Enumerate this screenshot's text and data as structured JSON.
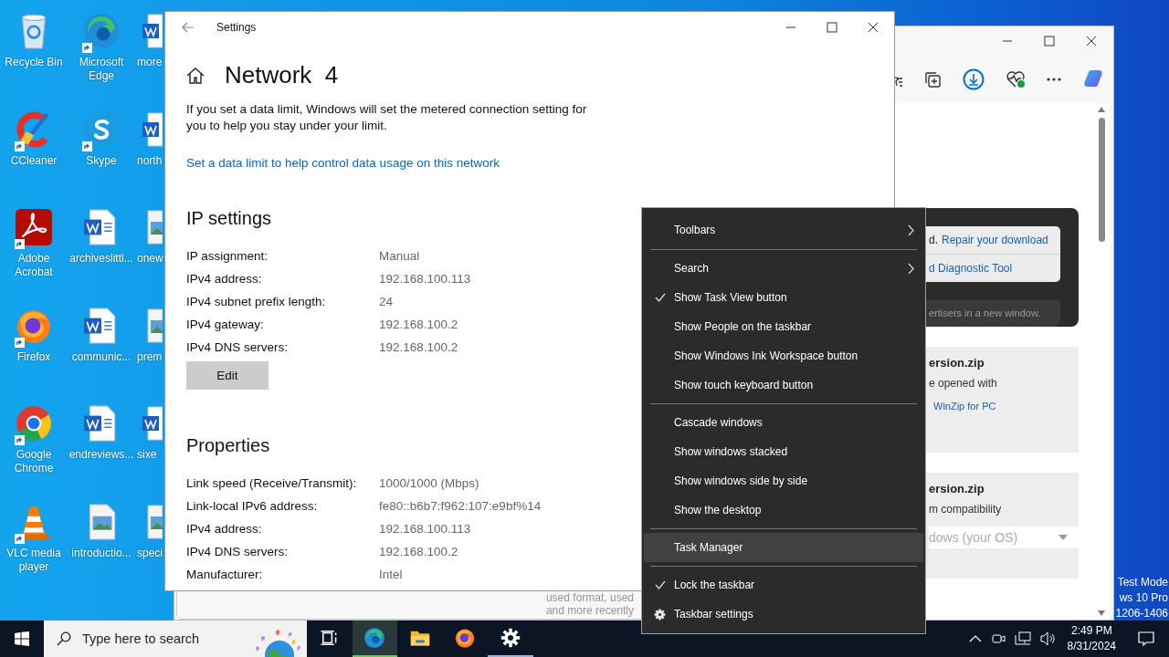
{
  "desktop_icons": [
    {
      "label": "Recycle Bin",
      "kind": "recycle",
      "shortcut": false
    },
    {
      "label": "CCleaner",
      "kind": "ccleaner",
      "shortcut": true
    },
    {
      "label": "Adobe Acrobat",
      "kind": "acrobat",
      "shortcut": true
    },
    {
      "label": "Firefox",
      "kind": "firefox",
      "shortcut": true
    },
    {
      "label": "Google Chrome",
      "kind": "chrome",
      "shortcut": true
    },
    {
      "label": "VLC media player",
      "kind": "vlc",
      "shortcut": true
    },
    {
      "label": "Microsoft Edge",
      "kind": "edge",
      "shortcut": true
    },
    {
      "label": "Skype",
      "kind": "skype",
      "shortcut": true
    },
    {
      "label": "archiveslittl...",
      "kind": "word",
      "shortcut": false
    },
    {
      "label": "communic...",
      "kind": "word",
      "shortcut": false
    },
    {
      "label": "endreviews...",
      "kind": "word",
      "shortcut": false
    },
    {
      "label": "introductio...",
      "kind": "image",
      "shortcut": false
    },
    {
      "label": "more",
      "kind": "word",
      "shortcut": false
    },
    {
      "label": "north",
      "kind": "word",
      "shortcut": false
    },
    {
      "label": "onew",
      "kind": "image",
      "shortcut": false
    },
    {
      "label": "prem",
      "kind": "image",
      "shortcut": false
    },
    {
      "label": "sixe",
      "kind": "word",
      "shortcut": false
    },
    {
      "label": "speci",
      "kind": "image",
      "shortcut": false
    }
  ],
  "test_mode_lines": [
    "Test Mode",
    "ws 10 Pro",
    "1206-1406"
  ],
  "browser_window": {
    "notice_links": [
      {
        "text": "d.",
        "link": "Repair your download"
      },
      {
        "link": "d Diagnostic Tool"
      }
    ],
    "ad_note": "ertisers in a new window.",
    "cards": [
      {
        "title": "ersion.zip",
        "text": "e opened with",
        "link": "WinZip for PC"
      },
      {
        "title": "ersion.zip",
        "text": "m compatibility",
        "dropdown": "dows (your OS)"
      }
    ],
    "footer_lines": [
      "used format, used",
      "and more recently"
    ]
  },
  "settings_window": {
    "title": "Settings",
    "heading": "Network  4",
    "intro": "If you set a data limit, Windows will set the metered connection setting for you to help you stay under your limit.",
    "data_limit_link": "Set a data limit to help control data usage on this network",
    "sections": [
      {
        "title": "IP settings",
        "rows": [
          {
            "label": "IP assignment:",
            "value": "Manual"
          },
          {
            "label": "IPv4 address:",
            "value": "192.168.100.113"
          },
          {
            "label": "IPv4 subnet prefix length:",
            "value": "24"
          },
          {
            "label": "IPv4 gateway:",
            "value": "192.168.100.2"
          },
          {
            "label": "IPv4 DNS servers:",
            "value": "192.168.100.2"
          }
        ],
        "button": "Edit"
      },
      {
        "title": "Properties",
        "rows": [
          {
            "label": "Link speed (Receive/Transmit):",
            "value": "1000/1000 (Mbps)"
          },
          {
            "label": "Link-local IPv6 address:",
            "value": "fe80::b6b7:f962:107:e9bf%14"
          },
          {
            "label": "IPv4 address:",
            "value": "192.168.100.113"
          },
          {
            "label": "IPv4 DNS servers:",
            "value": "192.168.100.2"
          },
          {
            "label": "Manufacturer:",
            "value": "Intel"
          }
        ]
      }
    ]
  },
  "context_menu": [
    {
      "kind": "submenu",
      "label": "Toolbars",
      "selected": false
    },
    {
      "kind": "separator"
    },
    {
      "kind": "submenu",
      "label": "Search",
      "selected": false
    },
    {
      "kind": "toggle",
      "label": "Show Task View button",
      "checked": true,
      "selected": false
    },
    {
      "kind": "toggle",
      "label": "Show People on the taskbar",
      "checked": false,
      "selected": false
    },
    {
      "kind": "toggle",
      "label": "Show Windows Ink Workspace button",
      "checked": false,
      "selected": false
    },
    {
      "kind": "toggle",
      "label": "Show touch keyboard button",
      "checked": false,
      "selected": false
    },
    {
      "kind": "separator"
    },
    {
      "kind": "command",
      "label": "Cascade windows",
      "selected": false
    },
    {
      "kind": "command",
      "label": "Show windows stacked",
      "selected": false
    },
    {
      "kind": "command",
      "label": "Show windows side by side",
      "selected": false
    },
    {
      "kind": "command",
      "label": "Show the desktop",
      "selected": false
    },
    {
      "kind": "separator"
    },
    {
      "kind": "command",
      "label": "Task Manager",
      "selected": true
    },
    {
      "kind": "separator"
    },
    {
      "kind": "toggle",
      "label": "Lock the taskbar",
      "checked": true,
      "selected": false
    },
    {
      "kind": "settings",
      "label": "Taskbar settings",
      "selected": false
    }
  ],
  "taskbar": {
    "search_placeholder": "Type here to search",
    "apps": [
      {
        "kind": "task-view",
        "running": false,
        "active": false
      },
      {
        "kind": "edge",
        "running": true,
        "active": true
      },
      {
        "kind": "explorer",
        "running": false,
        "active": false
      },
      {
        "kind": "firefox",
        "running": false,
        "active": false
      },
      {
        "kind": "settings",
        "running": true,
        "active": false
      }
    ],
    "time": "2:49 PM",
    "date": "8/31/2024"
  }
}
